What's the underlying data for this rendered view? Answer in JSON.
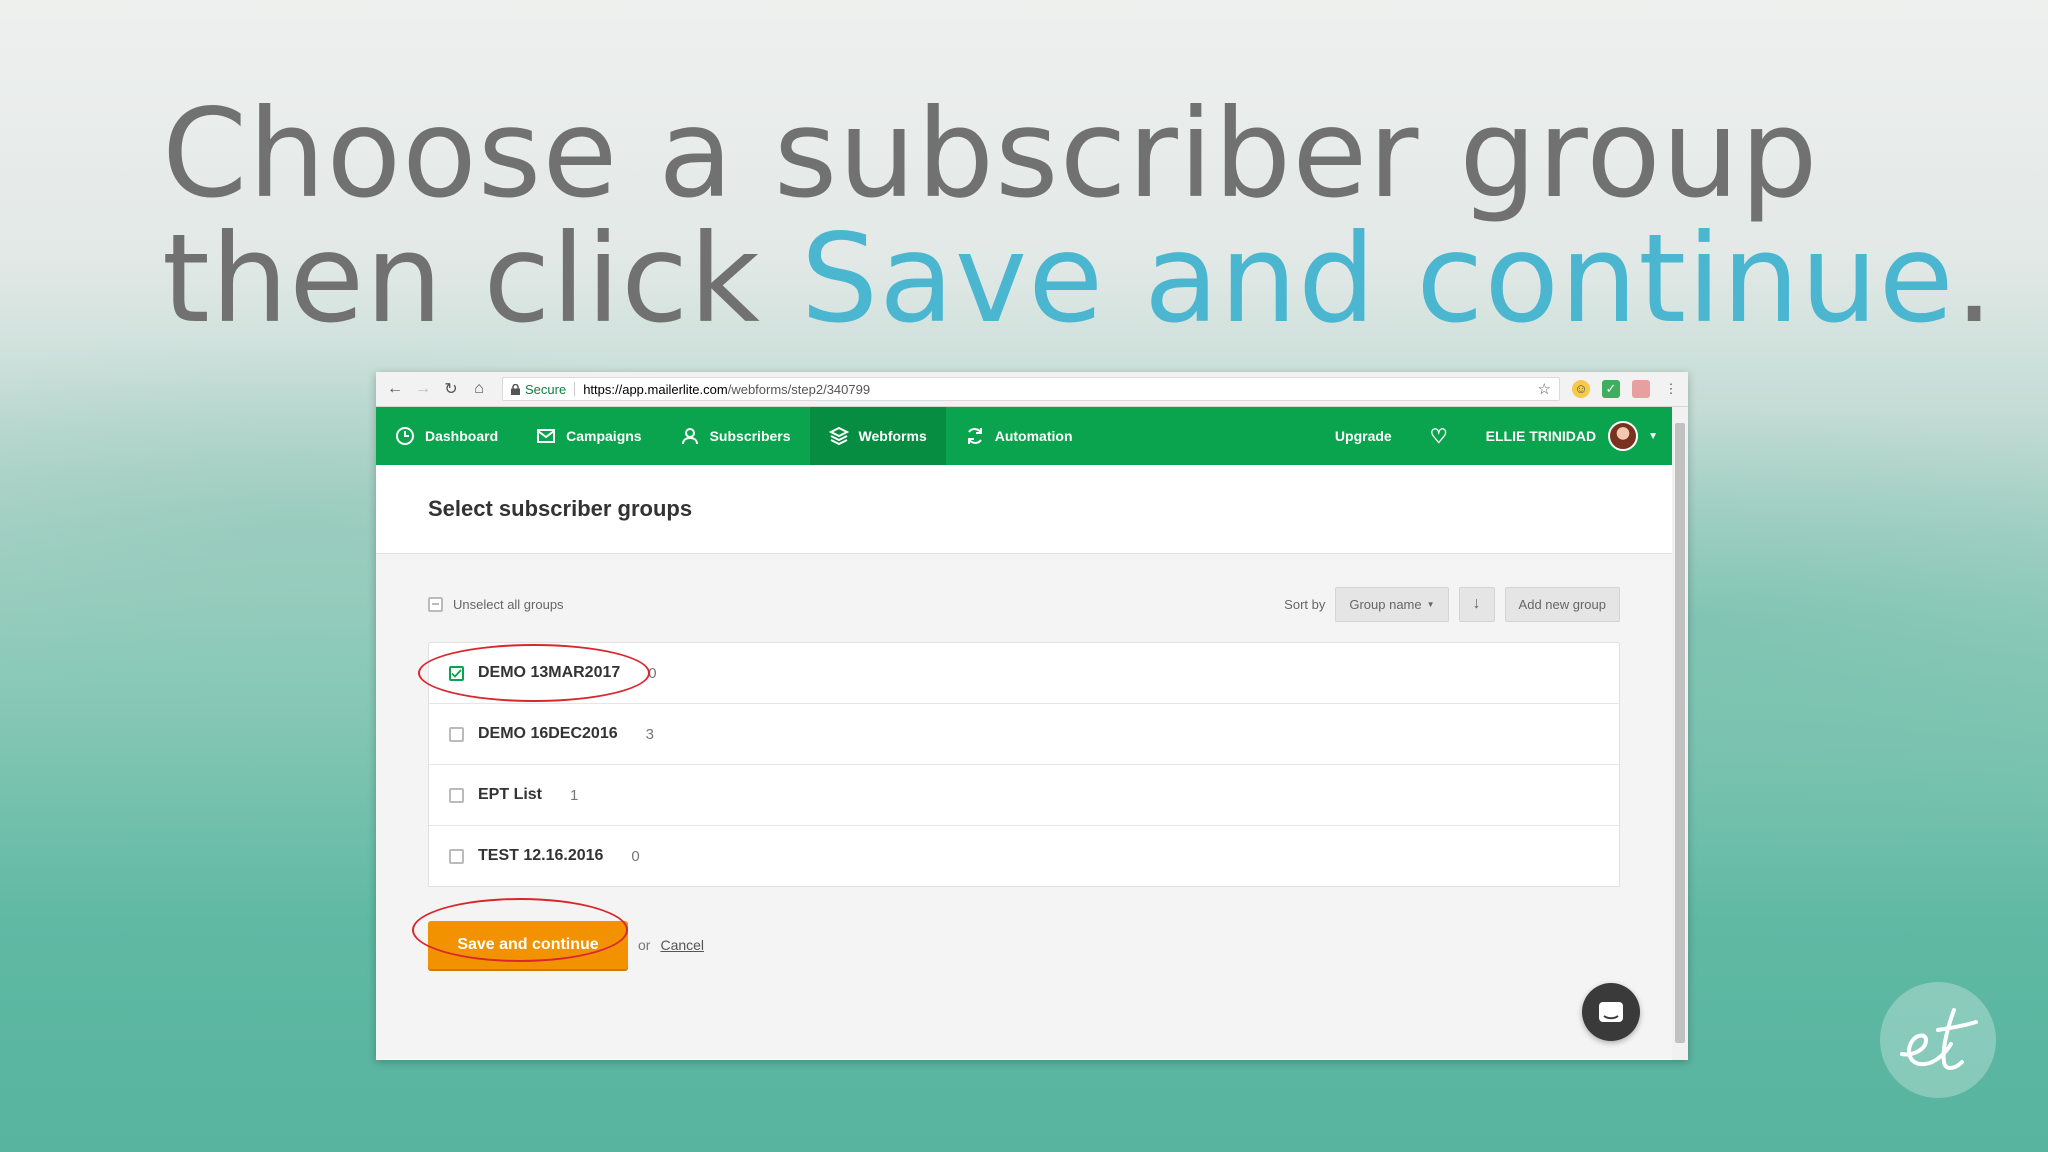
{
  "slide": {
    "line1": "Choose a subscriber group",
    "line2_plain": "then click ",
    "line2_accent": "Save and continue",
    "line2_end": ".",
    "accent_color": "#4bb6cf"
  },
  "browser": {
    "secure_label": "Secure",
    "url_scheme_host": "https://app.mailerlite.com",
    "url_path": "/webforms/step2/340799"
  },
  "nav": {
    "items": [
      {
        "label": "Dashboard",
        "icon": "clock-icon"
      },
      {
        "label": "Campaigns",
        "icon": "envelope-icon"
      },
      {
        "label": "Subscribers",
        "icon": "user-icon"
      },
      {
        "label": "Webforms",
        "icon": "layers-icon",
        "active": true
      },
      {
        "label": "Automation",
        "icon": "refresh-icon"
      }
    ],
    "upgrade": "Upgrade",
    "user_name": "ELLIE TRINIDAD",
    "brand_color": "#09a44d"
  },
  "page": {
    "title": "Select subscriber groups",
    "unselect_all": "Unselect all groups",
    "sort_by": "Sort by",
    "sort_value": "Group name",
    "add_group": "Add new group",
    "groups": [
      {
        "name": "DEMO 13MAR2017",
        "count": "0",
        "checked": true
      },
      {
        "name": "DEMO 16DEC2016",
        "count": "3",
        "checked": false
      },
      {
        "name": "EPT List",
        "count": "1",
        "checked": false
      },
      {
        "name": "TEST 12.16.2016",
        "count": "0",
        "checked": false
      }
    ],
    "save_label": "Save and continue",
    "or_text": "or",
    "cancel_label": "Cancel",
    "save_color": "#f39200",
    "highlight_color": "#d9272e"
  }
}
